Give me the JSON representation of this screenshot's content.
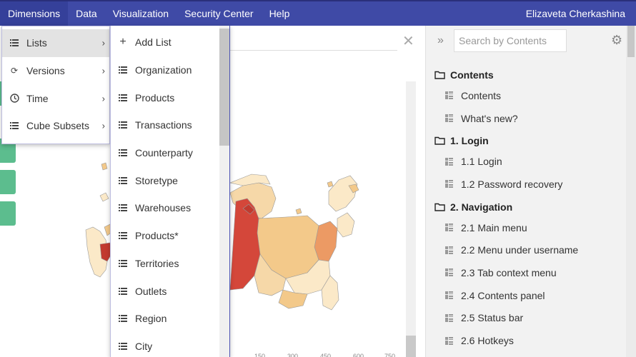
{
  "menubar": {
    "items": [
      "Dimensions",
      "Data",
      "Visualization",
      "Security Center",
      "Help"
    ],
    "user": "Elizaveta Cherkashina"
  },
  "dimensions_menu": {
    "items": [
      {
        "label": "Lists",
        "icon": "list-icon"
      },
      {
        "label": "Versions",
        "icon": "refresh-icon"
      },
      {
        "label": "Time",
        "icon": "clock-icon"
      },
      {
        "label": "Cube Subsets",
        "icon": "list-icon"
      }
    ]
  },
  "lists_menu": {
    "add_label": "Add List",
    "items": [
      "Organization",
      "Products",
      "Transactions",
      "Counterparty",
      "Storetype",
      "Warehouses",
      "Products*",
      "Territories",
      "Outlets",
      "Region",
      "City"
    ]
  },
  "main": {
    "close_icon": "close-icon"
  },
  "contents_panel": {
    "search_placeholder": "Search by Contents",
    "sections": [
      {
        "title": "Contents",
        "items": [
          "Contents",
          "What's new?"
        ]
      },
      {
        "title": "1. Login",
        "items": [
          "1.1 Login",
          "1.2 Password recovery"
        ]
      },
      {
        "title": "2. Navigation",
        "items": [
          "2.1 Main menu",
          "2.2 Menu under username",
          "2.3 Tab context menu",
          "2.4 Contents panel",
          "2.5 Status bar",
          "2.6 Hotkeys"
        ]
      }
    ]
  },
  "colors": {
    "menubar": "#3f4aa6",
    "accent_green": "#5cbd8e",
    "map_dark": "#d4473a",
    "map_mid": "#f3c98a",
    "map_light": "#fbe9c8"
  }
}
